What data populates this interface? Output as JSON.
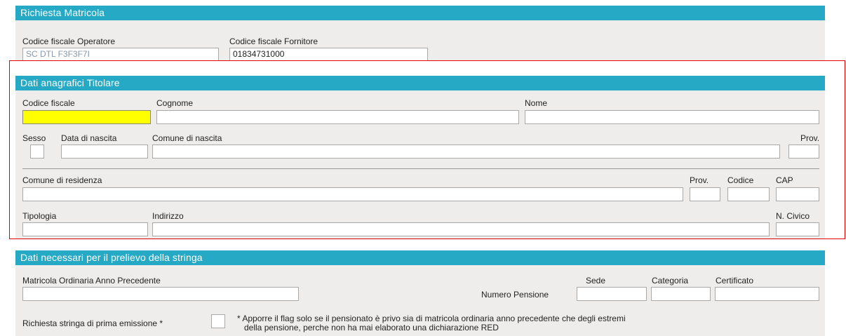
{
  "sections": {
    "richiesta": {
      "title": "Richiesta Matricola"
    },
    "anagrafici": {
      "title": "Dati anagrafici Titolare"
    },
    "prelievo": {
      "title": "Dati necessari per il prelievo della stringa"
    }
  },
  "richiesta": {
    "cf_operatore_label": "Codice fiscale Operatore",
    "cf_operatore_value": "SC DTL  F3F3F7I",
    "cf_fornitore_label": "Codice fiscale Fornitore",
    "cf_fornitore_value": "01834731000"
  },
  "anagrafici": {
    "codice_fiscale_label": "Codice fiscale",
    "cognome_label": "Cognome",
    "nome_label": "Nome",
    "sesso_label": "Sesso",
    "data_nascita_label": "Data di nascita",
    "comune_nascita_label": "Comune di nascita",
    "prov_nascita_label": "Prov.",
    "comune_residenza_label": "Comune di residenza",
    "prov_residenza_label": "Prov.",
    "codice_label": "Codice",
    "cap_label": "CAP",
    "tipologia_label": "Tipologia",
    "indirizzo_label": "Indirizzo",
    "civico_label": "N. Civico"
  },
  "prelievo": {
    "matricola_label": "Matricola Ordinaria Anno Precedente",
    "sede_label": "Sede",
    "categoria_label": "Categoria",
    "certificato_label": "Certificato",
    "numero_pensione_label": "Numero Pensione",
    "prima_emissione_label": "Richiesta stringa di prima emissione *",
    "note_line1": "* Apporre il flag solo se il pensionato è privo sia di matricola ordinaria anno precedente che degli estremi",
    "note_line2": "della pensione, perche non ha mai elaborato una dichiarazione RED"
  },
  "colors": {
    "section_bar": "#26a9c4",
    "panel_bg": "#efedeb",
    "highlight_field": "#ffff00",
    "annotation_border": "#e00000"
  }
}
